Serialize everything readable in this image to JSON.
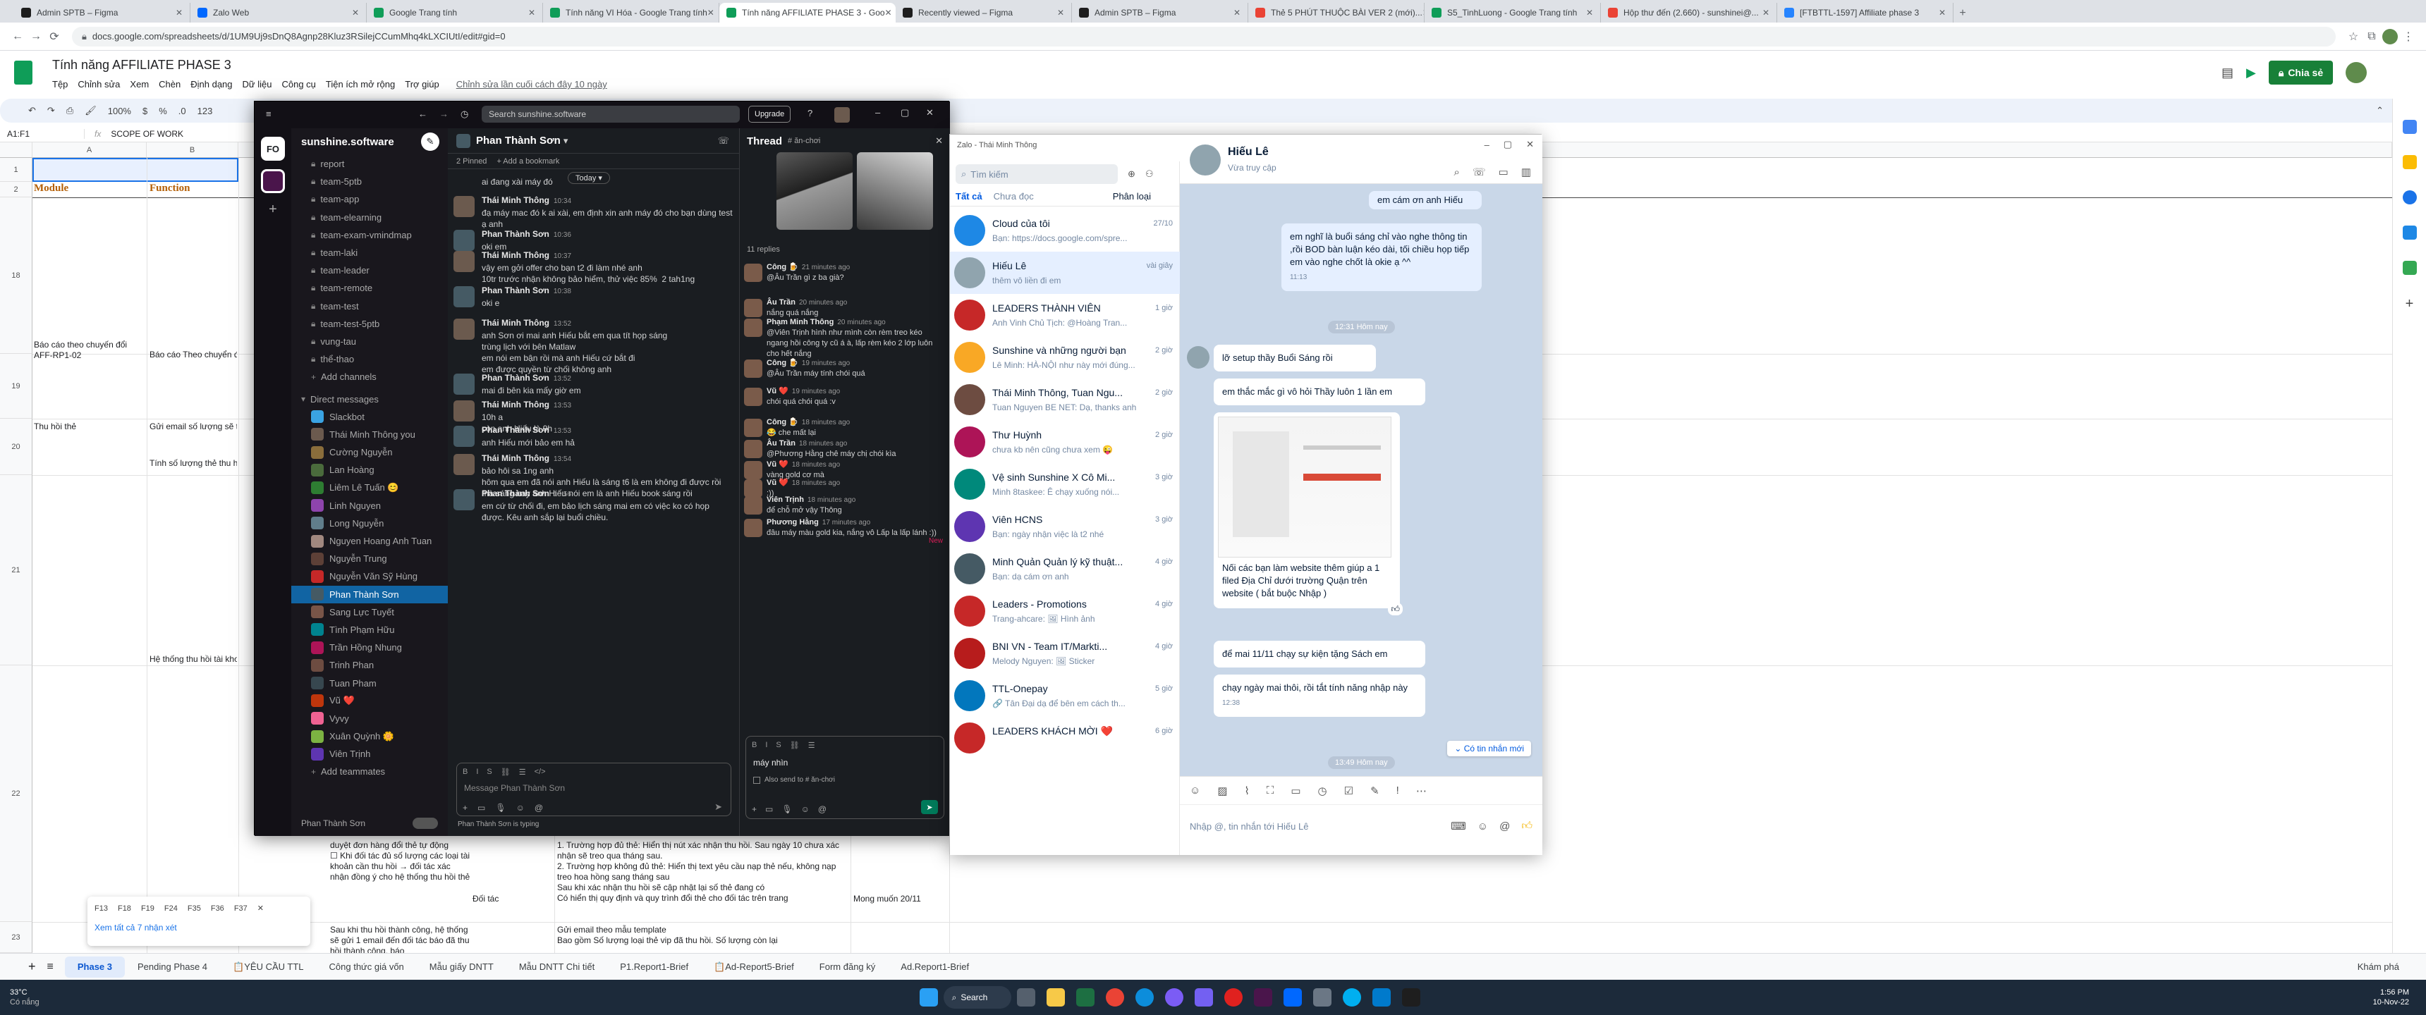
{
  "browser": {
    "tabs": [
      {
        "label": "Admin SPTB – Figma",
        "color": "#1e1e1e"
      },
      {
        "label": "Zalo Web",
        "color": "#0068ff"
      },
      {
        "label": "Google Trang tính",
        "color": "#0f9d58"
      },
      {
        "label": "Tính năng VI Hóa - Google Trang tính",
        "color": "#0f9d58"
      },
      {
        "label": "Tính năng AFFILIATE PHASE 3 - Goo",
        "color": "#0f9d58"
      },
      {
        "label": "Recently viewed – Figma",
        "color": "#1e1e1e"
      },
      {
        "label": "Admin SPTB – Figma",
        "color": "#1e1e1e"
      },
      {
        "label": "Thẻ 5 PHÚT THUỘC BÀI VER 2 (mới)...",
        "color": "#ea4335"
      },
      {
        "label": "S5_TinhLuong - Google Trang tính",
        "color": "#0f9d58"
      },
      {
        "label": "Hộp thư đến (2.660) - sunshinei@...",
        "color": "#ea4335"
      },
      {
        "label": "[FTBTTL-1597] Affiliate phase 3",
        "color": "#2684ff"
      }
    ],
    "url": "docs.google.com/spreadsheets/d/1UM9Uj9sDnQ8Agnp28Kluz3RSilejCCumMhq4kLXCIUtI/edit#gid=0"
  },
  "sheet": {
    "title": "Tính năng AFFILIATE PHASE 3",
    "menus": [
      "Tệp",
      "Chỉnh sửa",
      "Xem",
      "Chèn",
      "Định dạng",
      "Dữ liệu",
      "Công cụ",
      "Tiện ích mở rộng",
      "Trợ giúp"
    ],
    "last_edit": "Chỉnh sửa lần cuối cách đây 10 ngày",
    "share_label": "Chia sẻ",
    "cell_ref": "A1:F1",
    "formula": "SCOPE OF WORK",
    "zoom": "100%",
    "col_headers": [
      "A",
      "B"
    ],
    "row_numbers": [
      "1",
      "2",
      "18",
      "19",
      "20",
      "21",
      "22",
      "23"
    ],
    "header_module": "Module",
    "header_function": "Function",
    "cells": {
      "r18a": "Báo cáo theo chuyến đổi AFF-RP1-02",
      "r18b": "Báo cáo Theo chuyển đổi",
      "r19a": "Thu hồi thẻ",
      "r19b": "Gửi email số lượng sẽ th",
      "r20b": "Tính số lượng thẻ thu hồi",
      "r21b": "Hệ thống thu hồi tài khoả",
      "r22c": "duyệt đơn hàng đổi thẻ tự động\n☐ Khi đối tác đủ số lượng các loại tài khoản cần thu hồi → đối tác xác nhận đồng ý cho hệ thống thu hồi thẻ",
      "r22d": "1. Trường hợp đủ thẻ: Hiển thị nút xác nhận thu hồi. Sau ngày 10 chưa xác nhận sẽ treo qua tháng sau.\n2. Trường hợp không đủ thẻ: Hiển thị text yêu cầu nạp thẻ nếu, không nạp treo hoa hồng sang tháng sau\nSau khi xác nhận thu hồi sẽ cập nhật lại số thẻ đang có\nCó hiển thị quy định và quy trình đổi thẻ cho đối tác trên trang",
      "r22e": "Đối tác",
      "r22f": "Mong muốn 20/11",
      "r23c": "Sau khi thu hồi thành công, hệ thống sẽ gửi 1 email đến đối tác báo đã thu hồi thành công, báo",
      "r23d": "Gửi email theo mẫu template\nBao gồm Số lượng loại thẻ vip đã thu hồi. Số lượng còn lại"
    },
    "filter_chips": [
      "F13",
      "F18",
      "F19",
      "F24",
      "F35",
      "F36",
      "F37"
    ],
    "see_all_notes": "Xem tất cả 7 nhận xét",
    "sheet_tabs": [
      "Phase 3",
      "Pending Phase 4",
      "📋YÊU CẦU TTL",
      "Công thức giá vốn",
      "Mẫu giấy DNTT",
      "Mẫu DNTT Chi tiết",
      "P1.Report1-Brief",
      "📋Ad-Report5-Brief",
      "Form đăng ký",
      "Ad.Report1-Brief"
    ],
    "explore_label": "Khám phá"
  },
  "slack": {
    "workspace": "sunshine.software",
    "search_placeholder": "Search sunshine.software",
    "upgrade_label": "Upgrade",
    "channels": [
      "report",
      "team-5ptb",
      "team-app",
      "team-elearning",
      "team-exam-vmindmap",
      "team-laki",
      "team-leader",
      "team-remote",
      "team-test",
      "team-test-5ptb",
      "vung-tau",
      "thể-thao"
    ],
    "add_channels": "Add channels",
    "dm_header": "Direct messages",
    "dms": [
      {
        "name": "Slackbot",
        "color": "#3aa3e3"
      },
      {
        "name": "Thái Minh Thông  you",
        "color": "#6b5a4e"
      },
      {
        "name": "Cường Nguyễn",
        "color": "#8a6d3b"
      },
      {
        "name": "Lan Hoàng",
        "color": "#4a6b3c"
      },
      {
        "name": "Liêm Lê Tuấn 😊",
        "color": "#2e7d32"
      },
      {
        "name": "Linh Nguyen",
        "color": "#8e44ad"
      },
      {
        "name": "Long Nguyễn",
        "color": "#607d8b"
      },
      {
        "name": "Nguyen Hoang Anh Tuan",
        "color": "#a1887f"
      },
      {
        "name": "Nguyễn Trung",
        "color": "#5d4037"
      },
      {
        "name": "Nguyễn Văn Sỹ Hùng",
        "color": "#c62828"
      },
      {
        "name": "Phan Thành Sơn",
        "color": "#455a64"
      },
      {
        "name": "Sang Lực Tuyết",
        "color": "#795548"
      },
      {
        "name": "Tình Phạm Hữu",
        "color": "#00838f"
      },
      {
        "name": "Trần Hồng Nhung",
        "color": "#ad1457"
      },
      {
        "name": "Trinh Phan",
        "color": "#6d4c41"
      },
      {
        "name": "Tuan Pham",
        "color": "#37474f"
      },
      {
        "name": "Vũ ❤️",
        "color": "#bf360c"
      },
      {
        "name": "Vyvy",
        "color": "#f06292"
      },
      {
        "name": "Xuân Quỳnh 🌼",
        "color": "#7cb342"
      },
      {
        "name": "Viên Trịnh",
        "color": "#5e35b1"
      }
    ],
    "add_teammates": "Add teammates",
    "footer_user": "Phan Thành Sơn",
    "channel_title": "Phan Thành Sơn",
    "pinned": "2 Pinned",
    "add_bookmark": "+ Add a bookmark",
    "today_label": "Today",
    "composer_placeholder": "Message Phan Thành Sơn",
    "typing": "Phan Thành Sơn is typing",
    "messages": [
      {
        "name": "",
        "time": "",
        "text": "ai đang xài máy đó"
      },
      {
        "name": "Thái Minh Thông",
        "time": "10:34",
        "text": "đạ máy mac đó k ai xài, em định xin anh máy đó cho bạn dùng test ạ anh"
      },
      {
        "name": "Phan Thành Sơn",
        "time": "10:36",
        "text": "oki em"
      },
      {
        "name": "Thái Minh Thông",
        "time": "10:37",
        "text": "vậy em gởi offer cho bạn t2 đi làm nhé anh\n10tr trước nhận không bảo hiểm, thử việc 85%  2 tah1ng"
      },
      {
        "name": "Phan Thành Sơn",
        "time": "10:38",
        "text": "oki e"
      },
      {
        "name": "Thái Minh Thông",
        "time": "13:52",
        "text": "anh Sơn ơi mai anh Hiếu bắt em qua tít họp sáng\ntrùng lịch với bên Matlaw\nem nói em bận rồi mà anh Hiếu cứ bắt đi\nem được quyền từ chối không anh"
      },
      {
        "name": "Phan Thành Sơn",
        "time": "13:52",
        "text": "mai đi bên kia mấy giờ em"
      },
      {
        "name": "Thái Minh Thông",
        "time": "13:53",
        "text": "10h a\ncòn anh Hiếu là 9h"
      },
      {
        "name": "Phan Thành Sơn",
        "time": "13:53",
        "text": "anh Hiếu mới bảo em hả"
      },
      {
        "name": "Thái Minh Thông",
        "time": "13:54",
        "text": "bảo hôi sa 1ng anh\nhôm qua em đã nói anh Hiếu là sáng t6 là em không đi được rồi\nmà sáng nay anh Hiếu nói em là anh Hiếu book sáng rồi"
      },
      {
        "name": "Phan Thành Sơn",
        "time": "13:56",
        "text": "em cứ từ chối đi, em bảo lịch sáng mai em có việc ko có họp được. Kêu anh sắp lại buổi chiều."
      }
    ],
    "thread": {
      "title": "Thread",
      "channel": "# ăn-chơi",
      "replies": "11 replies",
      "new_label": "New",
      "composer_text": "máy nhìn",
      "also_send": "Also send to # ăn-chơi",
      "messages": [
        {
          "name": "Công 🍺",
          "time": "21 minutes ago",
          "text": "@Âu Trần gì z ba già?"
        },
        {
          "name": "Âu Trần",
          "time": "20 minutes ago",
          "text": "nắng quá nắng"
        },
        {
          "name": "Phạm Minh Thông",
          "time": "20 minutes ago",
          "text": "@Viên Trịnh hình như mình còn rèm treo kéo ngang hồi công ty cũ á à, lấp rèm kéo 2 lớp luôn cho hết nắng"
        },
        {
          "name": "Công 🍺",
          "time": "19 minutes ago",
          "text": "@Âu Trần máy tính chói quá"
        },
        {
          "name": "Vũ ❤️",
          "time": "19 minutes ago",
          "text": "chói quá chói quá :v"
        },
        {
          "name": "Công 🍺",
          "time": "18 minutes ago",
          "text": "😂 che mất lại"
        },
        {
          "name": "Âu Trần",
          "time": "18 minutes ago",
          "text": "@Phương Hằng chê máy chị chói kìa"
        },
        {
          "name": "Vũ ❤️",
          "time": "18 minutes ago",
          "text": "vàng gold cơ mà"
        },
        {
          "name": "Vũ ❤️",
          "time": "18 minutes ago",
          "text": ":))"
        },
        {
          "name": "Viên Trịnh",
          "time": "18 minutes ago",
          "text": "để chỗ mở vậy Thông"
        },
        {
          "name": "Phương Hằng",
          "time": "17 minutes ago",
          "text": "đâu máy màu gold kia, nắng vô Lấp la lấp lánh :))"
        }
      ]
    }
  },
  "zalo": {
    "window_title": "Zalo - Thái Minh Thông",
    "search_placeholder": "Tìm kiếm",
    "filter_all": "Tất cả",
    "filter_unread": "Chưa đọc",
    "classify": "Phân loại",
    "conversations": [
      {
        "name": "Cloud của tôi",
        "preview": "Bạn: https://docs.google.com/spre...",
        "time": "27/10",
        "color": "#1e88e5"
      },
      {
        "name": "Hiếu Lê",
        "preview": "thêm vô liền đi em",
        "time": "vài giây",
        "color": "#90a4ae"
      },
      {
        "name": "LEADERS THÀNH VIÊN",
        "preview": "Anh Vinh Chủ Tịch: @Hoàng Tran...",
        "time": "1 giờ",
        "color": "#c62828"
      },
      {
        "name": "Sunshine và những người bạn",
        "preview": "Lê Minh: HÀ-NỘI như này mới đúng...",
        "time": "2 giờ",
        "color": "#f9a825"
      },
      {
        "name": "Thái Minh Thông, Tuan Ngu...",
        "preview": "Tuan Nguyen BE NET: Dạ, thanks anh",
        "time": "2 giờ",
        "color": "#6d4c41"
      },
      {
        "name": "Thư Huỳnh",
        "preview": "chưa kb nên cũng chưa xem 😜",
        "time": "2 giờ",
        "color": "#ad1457"
      },
      {
        "name": "Vệ sinh Sunshine X Cô Mi...",
        "preview": "Minh 8taskee: Ê chạy xuống nói...",
        "time": "3 giờ",
        "color": "#00897b"
      },
      {
        "name": "Viên HCNS",
        "preview": "Bạn: ngày nhận việc là t2 nhé",
        "time": "3 giờ",
        "color": "#5e35b1"
      },
      {
        "name": "Minh Quản Quản lý kỹ thuật...",
        "preview": "Bạn: dạ cám ơn anh",
        "time": "4 giờ",
        "color": "#455a64"
      },
      {
        "name": "Leaders - Promotions",
        "preview": "Trang-ahcare: 🖼 Hình ảnh",
        "time": "4 giờ",
        "color": "#c62828"
      },
      {
        "name": "BNI VN - Team IT/Markti...",
        "preview": "Melody Nguyen: 🖼 Sticker",
        "time": "4 giờ",
        "color": "#b71c1c"
      },
      {
        "name": "TTL-Onepay",
        "preview": "🔗 Tân Đại dạ để bên em cách th...",
        "time": "5 giờ",
        "color": "#0277bd"
      },
      {
        "name": "LEADERS KHÁCH MỜI ❤️",
        "preview": "",
        "time": "6 giờ",
        "color": "#c62828"
      }
    ],
    "chat": {
      "name": "Hiếu Lê",
      "status": "Vừa truy cập",
      "messages_top": [
        "em cám ơn anh Hiếu"
      ],
      "my_msg": "em nghĩ là buổi sáng chỉ vào nghe thông tin ,rồi BOD bàn luận kéo dài, tối chiều họp tiếp em vào nghe chốt là okie ạ ^^",
      "my_time": "11:13",
      "divider1": "12:31 Hôm nay",
      "in1": "lỡ setup thầy Buổi Sáng rồi",
      "in2": "em thắc mắc gì vô hỏi Thầy luôn 1 lần em",
      "img_caption": "Nối các bạn làm website thêm giúp a 1 filed Địa Chỉ dưới trường Quận trên website ( bắt buộc Nhập )",
      "in4": "để mai 11/11 chạy sự kiện tặng Sách em",
      "in5": "chạy ngày mai thôi, rồi tắt tính năng nhập này",
      "in5_time": "12:38",
      "divider2": "13:49 Hôm nay",
      "new_msg_badge": "Có tin nhắn mới",
      "composer_placeholder": "Nhập @, tin nhắn tới Hiếu Lê"
    }
  },
  "taskbar": {
    "weather": "33°C",
    "weather_sub": "Có nắng",
    "search_label": "Search",
    "time": "1:56 PM",
    "date": "10-Nov-22"
  }
}
